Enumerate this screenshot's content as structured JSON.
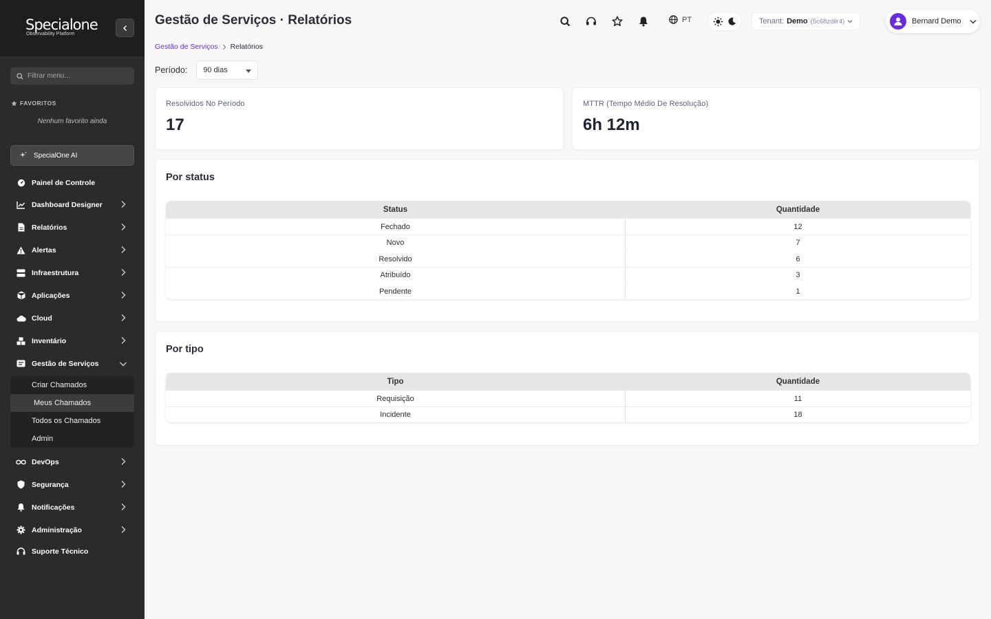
{
  "brand": {
    "name": "Specialone",
    "tagline": "Observability Platform"
  },
  "sidebar": {
    "search_placeholder": "Filtrar menu...",
    "favorites_title": "FAVORITOS",
    "favorites_empty": "Nenhum favorito ainda",
    "ai_label": "SpecialOne AI",
    "items": [
      {
        "label": "Painel de Controle",
        "icon": "gauge-icon"
      },
      {
        "label": "Dashboard Designer",
        "icon": "chart-line-icon"
      },
      {
        "label": "Relatórios",
        "icon": "file-icon"
      },
      {
        "label": "Alertas",
        "icon": "warning-icon"
      },
      {
        "label": "Infraestrutura",
        "icon": "server-icon"
      },
      {
        "label": "Aplicações",
        "icon": "cube-icon"
      },
      {
        "label": "Cloud",
        "icon": "cloud-icon"
      },
      {
        "label": "Inventário",
        "icon": "boxes-icon"
      },
      {
        "label": "Gestão de Serviços",
        "icon": "service-icon"
      },
      {
        "label": "DevOps",
        "icon": "infinity-icon"
      },
      {
        "label": "Segurança",
        "icon": "shield-icon"
      },
      {
        "label": "Notificações",
        "icon": "bell-icon"
      },
      {
        "label": "Administração",
        "icon": "gear-icon"
      },
      {
        "label": "Suporte Técnico",
        "icon": "headset-icon"
      }
    ],
    "sub_items": [
      "Criar Chamados",
      "Meus Chamados",
      "Todos os Chamados",
      "Admin"
    ]
  },
  "header": {
    "title": "Gestão de Serviços · Relatórios",
    "language": "PT",
    "tenant_label": "Tenant:",
    "tenant_name": "Demo",
    "tenant_id": "(5c68zdilr4)",
    "user_name": "Bernard Demo"
  },
  "breadcrumb": {
    "parent": "Gestão de Serviços",
    "current": "Relatórios"
  },
  "period": {
    "label": "Período:",
    "value": "90 dias"
  },
  "stats": {
    "resolved_label": "Resolvidos No Período",
    "resolved_value": "17",
    "mttr_label": "MTTR (Tempo Médio De Resolução)",
    "mttr_value": "6h 12m"
  },
  "by_status": {
    "title": "Por status",
    "col1": "Status",
    "col2": "Quantidade",
    "rows": [
      {
        "status": "Fechado",
        "qty": "12"
      },
      {
        "status": "Novo",
        "qty": "7"
      },
      {
        "status": "Resolvido",
        "qty": "6"
      },
      {
        "status": "Atribuído",
        "qty": "3"
      },
      {
        "status": "Pendente",
        "qty": "1"
      }
    ]
  },
  "by_type": {
    "title": "Por tipo",
    "col1": "Tipo",
    "col2": "Quantidade",
    "rows": [
      {
        "type": "Requisição",
        "qty": "11"
      },
      {
        "type": "Incidente",
        "qty": "18"
      }
    ]
  },
  "colors": {
    "accent": "#6a30c9",
    "sidebar_bg": "#2b2b2b",
    "avatar": "#6a2ed8"
  }
}
